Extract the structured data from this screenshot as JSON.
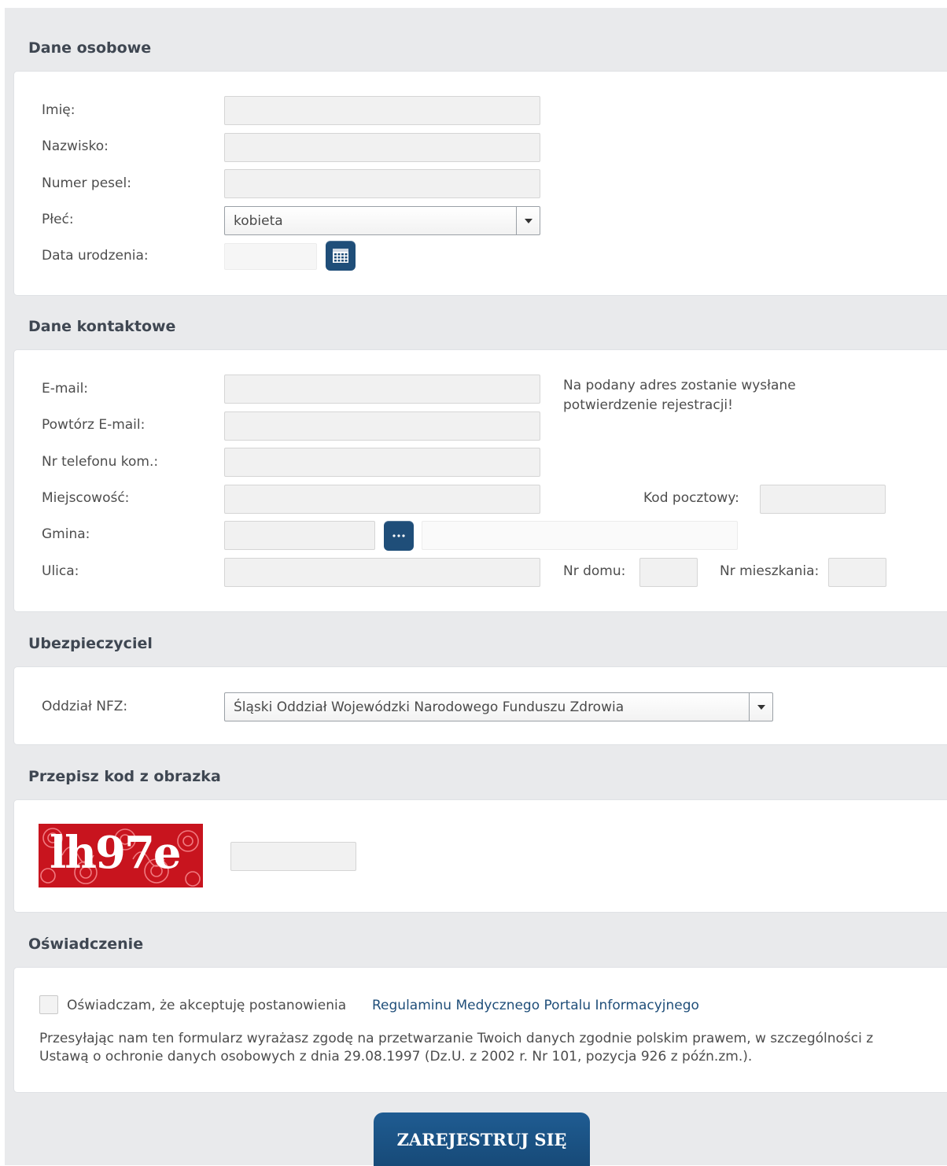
{
  "sections": {
    "personal": {
      "title": "Dane osobowe",
      "first_name_label": "Imię:",
      "last_name_label": "Nazwisko:",
      "pesel_label": "Numer pesel:",
      "gender_label": "Płeć:",
      "gender_value": "kobieta",
      "birth_date_label": "Data urodzenia:"
    },
    "contact": {
      "title": "Dane kontaktowe",
      "email_label": "E-mail:",
      "email_note": "Na podany adres zostanie wysłane potwierdzenie rejestracji!",
      "email_repeat_label": "Powtórz E-mail:",
      "phone_label": "Nr telefonu kom.:",
      "city_label": "Miejscowość:",
      "postal_code_label": "Kod pocztowy:",
      "commune_label": "Gmina:",
      "street_label": "Ulica:",
      "house_no_label": "Nr domu:",
      "apartment_no_label": "Nr mieszkania:"
    },
    "insurer": {
      "title": "Ubezpieczyciel",
      "branch_label": "Oddział NFZ:",
      "branch_value": "Śląski Oddział Wojewódzki Narodowego Funduszu Zdrowia"
    },
    "captcha": {
      "title": "Przepisz kod z obrazka",
      "image_text": "lh97e"
    },
    "statement": {
      "title": "Oświadczenie",
      "accept_text": "Oświadczam, że akceptuję postanowienia",
      "regulations_link": "Regulaminu Medycznego Portalu Informacyjnego",
      "consent_text": "Przesyłając nam ten formularz wyrażasz zgodę na przetwarzanie Twoich danych zgodnie polskim prawem, w szczególności z Ustawą o ochronie danych osobowych z dnia 29.08.1997 (Dz.U. z 2002 r. Nr 101, pozycja 926 z późn.zm.)."
    }
  },
  "submit_label": "ZAREJESTRUJ SIĘ",
  "icons": {
    "date_picker": "calendar-icon",
    "commune_picker": "ellipsis-icon"
  },
  "colors": {
    "accent": "#1f4e79",
    "page_bg": "#e9eaec",
    "captcha_bg": "#c8141e"
  }
}
